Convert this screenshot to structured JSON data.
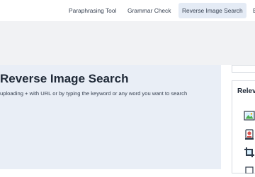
{
  "header": {
    "nav": [
      {
        "label": "Paraphrasing Tool",
        "active": false
      },
      {
        "label": "Grammar Check",
        "active": false
      },
      {
        "label": "Reverse Image Search",
        "active": true
      },
      {
        "label": "B",
        "active": false
      }
    ]
  },
  "main": {
    "title": "Reverse Image Search",
    "subtitle": "uploading + with URL or by typing the keyword or any word you want to search"
  },
  "sidebar": {
    "title": "Relev",
    "icons": [
      "image-landscape-icon",
      "document-stamp-icon",
      "crop-icon",
      "file-icon"
    ]
  },
  "colors": {
    "active_tab_bg": "#e4ebf5",
    "main_bg": "#e9eef6",
    "band_bg": "#f1f2f4",
    "icon_green": "#4caf50",
    "icon_red": "#d9534f"
  }
}
